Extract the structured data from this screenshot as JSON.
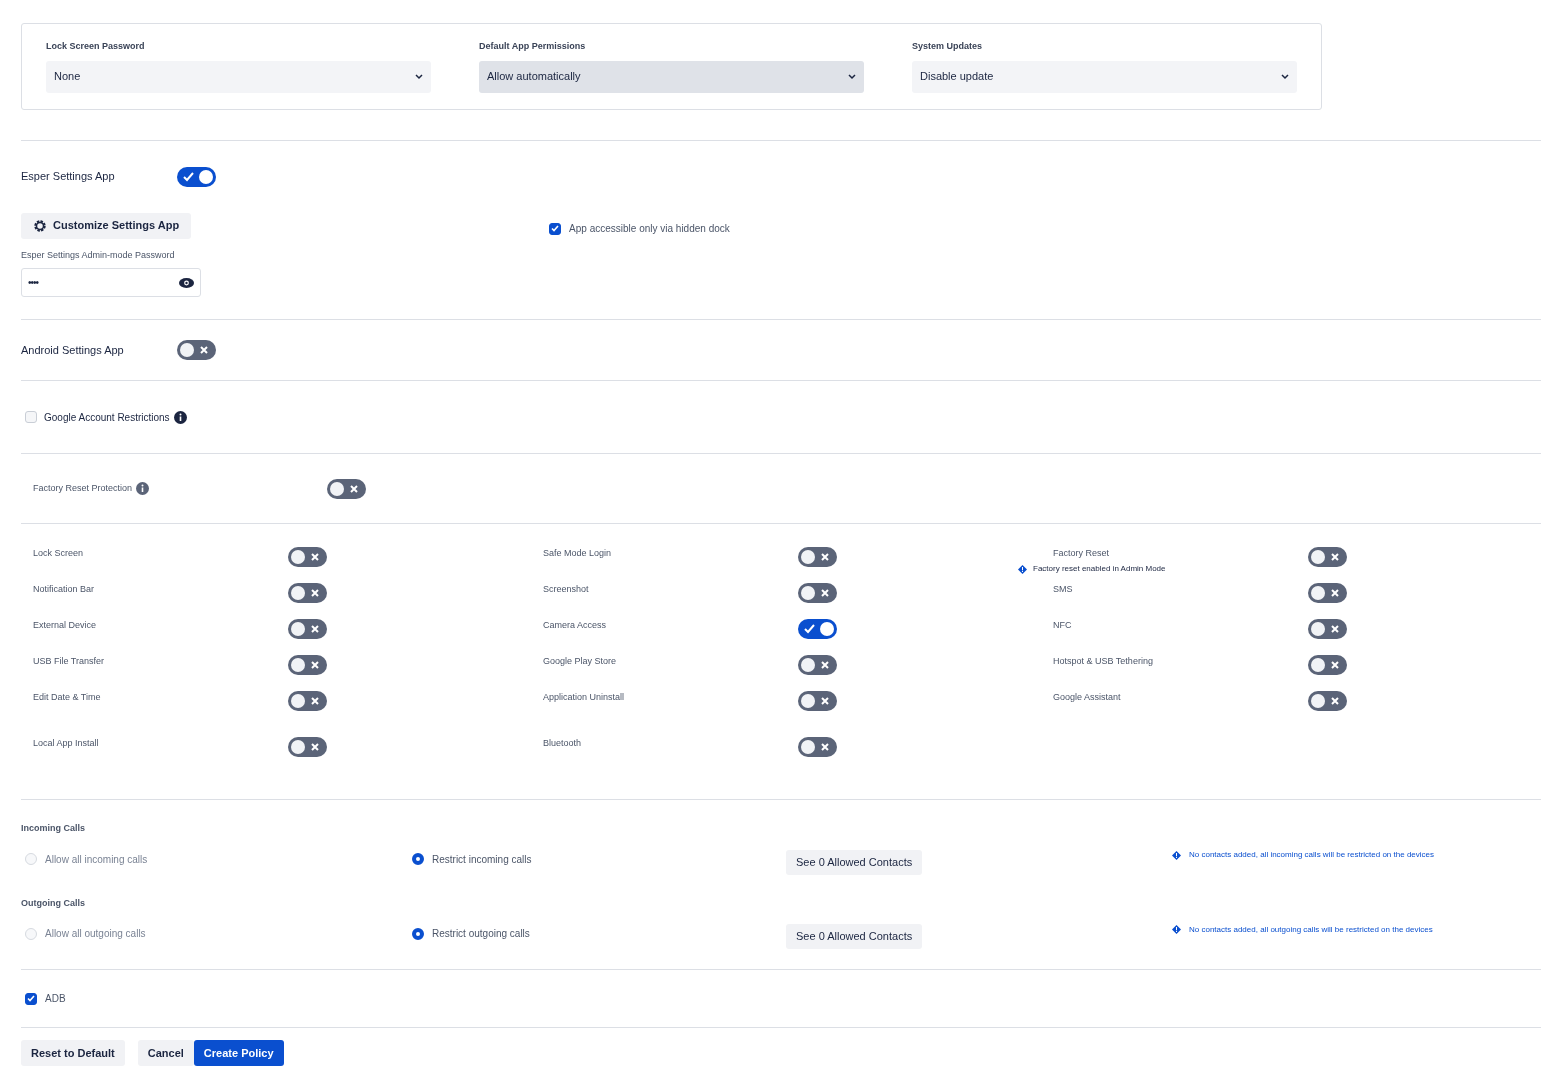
{
  "selects": [
    {
      "label": "Lock Screen Password",
      "value": "None",
      "selected": false
    },
    {
      "label": "Default App Permissions",
      "value": "Allow automatically",
      "selected": true
    },
    {
      "label": "System Updates",
      "value": "Disable update",
      "selected": false
    }
  ],
  "esper_settings": {
    "label": "Esper Settings App",
    "on": true,
    "customize_button": "Customize Settings App",
    "hidden_dock": {
      "label": "App accessible only via hidden dock",
      "checked": true
    },
    "password_label": "Esper Settings Admin-mode Password",
    "password_value": "••••"
  },
  "android_settings": {
    "label": "Android Settings App",
    "on": false
  },
  "google_account": {
    "label": "Google Account Restrictions",
    "checked": false
  },
  "factory_reset_protection": {
    "label": "Factory Reset Protection",
    "on": false
  },
  "restrictions": [
    {
      "label": "Lock Screen",
      "on": false
    },
    {
      "label": "Safe Mode Login",
      "on": false
    },
    {
      "label": "Factory Reset",
      "on": false,
      "note": "Factory reset enabled in Admin Mode"
    },
    {
      "label": "Notification Bar",
      "on": false
    },
    {
      "label": "Screenshot",
      "on": false
    },
    {
      "label": "SMS",
      "on": false
    },
    {
      "label": "External Device",
      "on": false
    },
    {
      "label": "Camera Access",
      "on": true
    },
    {
      "label": "NFC",
      "on": false
    },
    {
      "label": "USB File Transfer",
      "on": false
    },
    {
      "label": "Google Play Store",
      "on": false
    },
    {
      "label": "Hotspot & USB Tethering",
      "on": false
    },
    {
      "label": "Edit Date & Time",
      "on": false
    },
    {
      "label": "Application Uninstall",
      "on": false
    },
    {
      "label": "Google Assistant",
      "on": false
    },
    {
      "label": "Local App Install",
      "on": false
    },
    {
      "label": "Bluetooth",
      "on": false
    }
  ],
  "calls": [
    {
      "label": "Incoming Calls",
      "options": [
        {
          "label": "Allow all incoming calls",
          "selected": false
        },
        {
          "label": "Restrict incoming calls",
          "selected": true
        }
      ],
      "button": "See 0 Allowed Contacts",
      "note": "No contacts added, all incoming calls will be restricted on the devices"
    },
    {
      "label": "Outgoing Calls",
      "options": [
        {
          "label": "Allow all outgoing calls",
          "selected": false
        },
        {
          "label": "Restrict outgoing calls",
          "selected": true
        }
      ],
      "button": "See 0 Allowed Contacts",
      "note": "No contacts added, all outgoing calls will be restricted on the devices"
    }
  ],
  "adb": {
    "label": "ADB",
    "checked": true
  },
  "buttons": [
    {
      "label": "Reset to Default",
      "kind": "secondary"
    },
    {
      "label": "Cancel",
      "kind": "secondary"
    },
    {
      "label": "Create Policy",
      "kind": "primary"
    }
  ]
}
